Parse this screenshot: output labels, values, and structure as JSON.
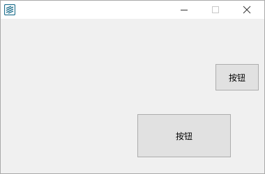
{
  "window": {
    "app_icon": "app-logo-icon",
    "accent_color": "#1c6e8c",
    "caption_buttons": {
      "minimize_icon": "minimize-icon",
      "maximize_icon": "maximize-icon",
      "close_icon": "close-icon"
    }
  },
  "content": {
    "button_small_label": "按钮",
    "button_large_label": "按钮"
  }
}
